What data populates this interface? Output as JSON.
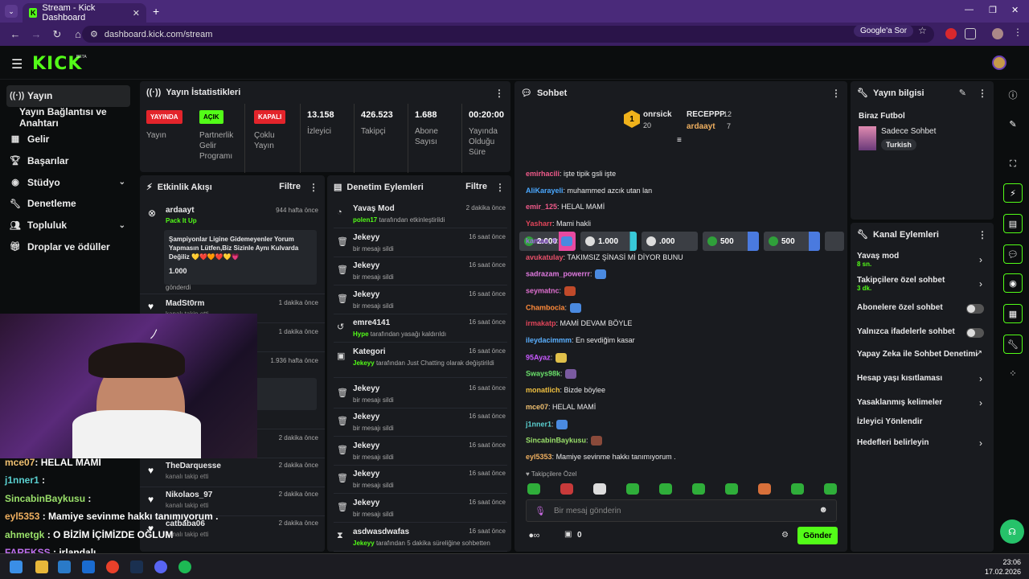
{
  "browser": {
    "tab_title": "Stream - Kick Dashboard",
    "url": "dashboard.kick.com/stream",
    "google_button": "Google'a Sor"
  },
  "header": {
    "logo": "KICK",
    "beta": "BETA"
  },
  "nav": {
    "items": [
      {
        "label": "Yayın",
        "icon": "broadcast-icon"
      },
      {
        "label": "Yayın Bağlantısı ve Anahtarı",
        "icon": ""
      },
      {
        "label": "Gelir",
        "icon": "chart-icon"
      },
      {
        "label": "Başarılar",
        "icon": "trophy-icon"
      },
      {
        "label": "Stüdyo",
        "icon": "studio-icon"
      },
      {
        "label": "Denetleme",
        "icon": "wrench-icon"
      },
      {
        "label": "Topluluk",
        "icon": "people-icon"
      },
      {
        "label": "Droplar ve ödüller",
        "icon": "gift-icon"
      }
    ]
  },
  "stats": {
    "title": "Yayın İstatistikleri",
    "cells": [
      {
        "badge": "YAYINDA",
        "label": "Yayın"
      },
      {
        "badge": "AÇIK",
        "label": "Partnerlik Gelir Programı"
      },
      {
        "badge": "KAPALI",
        "label": "Çoklu Yayın"
      },
      {
        "value": "13.158",
        "label": "İzleyici"
      },
      {
        "value": "426.523",
        "label": "Takipçi"
      },
      {
        "value": "1.688",
        "label": "Abone Sayısı"
      },
      {
        "value": "00:20:00",
        "label": "Yayında Olduğu Süre"
      }
    ]
  },
  "events": {
    "title": "Etkinlik Akışı",
    "filter": "Filtre",
    "first": {
      "name": "ardaayt",
      "sub": "Pack It Up",
      "time": "944 hafta önce",
      "message": "Şampiyonlar Ligine Gidemeyenler Yorum Yapmasın Lütfen,Biz Sizinle Aynı Kulvarda Değiliz 💛❤️🧡❤️💛💗",
      "amount": "1.000",
      "footer": "gönderdi"
    },
    "rows": [
      {
        "name": "MadSt0rm",
        "sub": "kanalı takip etti",
        "time": "1 dakika önce"
      },
      {
        "name": "",
        "sub": "",
        "time": "1 dakika önce"
      },
      {
        "name": "",
        "sub": "",
        "time": "1.936 hafta önce"
      },
      {
        "name": "",
        "sub": "",
        "time": "2 dakika önce"
      },
      {
        "name": "TheDarquesse",
        "sub": "kanalı takip etti",
        "time": "2 dakika önce"
      },
      {
        "name": "Nikolaos_97",
        "sub": "kanalı takip etti",
        "time": "2 dakika önce"
      },
      {
        "name": "catbaba06",
        "sub": "kanalı takip etti",
        "time": "2 dakika önce"
      }
    ]
  },
  "moderation": {
    "title": "Denetim Eylemleri",
    "filter": "Filtre",
    "rows": [
      {
        "name": "Yavaş Mod",
        "actor": "polen17",
        "sub": "tarafından etkinleştirildi",
        "time": "2 dakika önce",
        "icon": "slow-icon"
      },
      {
        "name": "Jekeyy",
        "actor": "",
        "sub": "bir mesajı sildi",
        "time": "16 saat önce",
        "icon": "trash-icon"
      },
      {
        "name": "Jekeyy",
        "actor": "",
        "sub": "bir mesajı sildi",
        "time": "16 saat önce",
        "icon": "trash-icon"
      },
      {
        "name": "Jekeyy",
        "actor": "",
        "sub": "bir mesajı sildi",
        "time": "16 saat önce",
        "icon": "trash-icon"
      },
      {
        "name": "emre4141",
        "actor": "Hype",
        "sub": "tarafından yasağı kaldırıldı",
        "time": "16 saat önce",
        "icon": "undo-icon"
      },
      {
        "name": "Kategori",
        "actor": "Jekeyy",
        "sub": "tarafından Just Chatting olarak değiştirildi",
        "time": "16 saat önce",
        "icon": "category-icon"
      },
      {
        "name": "Jekeyy",
        "actor": "",
        "sub": "bir mesajı sildi",
        "time": "16 saat önce",
        "icon": "trash-icon"
      },
      {
        "name": "Jekeyy",
        "actor": "",
        "sub": "bir mesajı sildi",
        "time": "16 saat önce",
        "icon": "trash-icon"
      },
      {
        "name": "Jekeyy",
        "actor": "",
        "sub": "bir mesajı sildi",
        "time": "16 saat önce",
        "icon": "trash-icon"
      },
      {
        "name": "Jekeyy",
        "actor": "",
        "sub": "bir mesajı sildi",
        "time": "16 saat önce",
        "icon": "trash-icon"
      },
      {
        "name": "Jekeyy",
        "actor": "",
        "sub": "bir mesajı sildi",
        "time": "16 saat önce",
        "icon": "trash-icon"
      },
      {
        "name": "asdwasdwafas",
        "actor": "Jekeyy",
        "sub": "tarafından 5 dakika süreliğine sohbetten",
        "time": "16 saat önce",
        "icon": "timer-icon"
      }
    ]
  },
  "chat": {
    "title": "Sohbet",
    "leaders": {
      "rank": "1",
      "first": {
        "name": "onrsick",
        "count": "20"
      },
      "second": {
        "name": "RECEPPP",
        "count": "12"
      },
      "third": {
        "name": "ardaayt",
        "count": "7"
      }
    },
    "gifts": [
      "2.000",
      "1.000",
      ".000",
      "500",
      "500"
    ],
    "messages": [
      {
        "user": "emirhacili",
        "text": "işte tipik gsli işte",
        "color": "#f05a8a"
      },
      {
        "user": "AliKarayeli",
        "text": "muhammed azcık utan lan",
        "color": "#4aa8ff"
      },
      {
        "user": "emir_125",
        "text": "HELAL MAMİ",
        "color": "#f05a8a"
      },
      {
        "user": "Yasharr",
        "text": "Mami hakli",
        "color": "#e0455a"
      },
      {
        "user": "kamaa_9",
        "text": "",
        "color": "#a06ae0"
      },
      {
        "user": "avukatulay",
        "text": "TAKIMSIZ ŞİNASİ Mİ DİYOR BUNU",
        "color": "#e8506a"
      },
      {
        "user": "sadrazam_powerrr",
        "text": "",
        "color": "#e07ae0"
      },
      {
        "user": "seymatnc",
        "text": "",
        "color": "#e070d0"
      },
      {
        "user": "Chambocia",
        "text": "",
        "color": "#ff8a3a"
      },
      {
        "user": "irmakatp",
        "text": "MAMİ DEVAM BÖYLE",
        "color": "#e0455a"
      },
      {
        "user": "ileydacimmm",
        "text": "En sevdiğim kasar",
        "color": "#5ab0ff"
      },
      {
        "user": "95Ayaz",
        "text": "",
        "color": "#c85aff"
      },
      {
        "user": "Sways98k",
        "text": "",
        "color": "#6ae06a"
      },
      {
        "user": "monatlich",
        "text": "Bizde böylee",
        "color": "#f0c040"
      },
      {
        "user": "mce07",
        "text": "HELAL MAMİ",
        "color": "#f0c070"
      },
      {
        "user": "j1nner1",
        "text": "",
        "color": "#5ad0d0"
      },
      {
        "user": "SincabinBaykusu",
        "text": "",
        "color": "#9ae06a"
      },
      {
        "user": "eyl5353",
        "text": "Mamiye sevinme hakkı tanımıyorum .",
        "color": "#f0b060"
      }
    ],
    "followers_only": "Takipçilere Özel",
    "input_placeholder": "Bir mesaj gönderin",
    "points": "0",
    "send": "Gönder"
  },
  "stream_info": {
    "title": "Yayın bilgisi",
    "stream_title": "Biraz Futbol",
    "category": "Sadece Sohbet",
    "tag": "Turkish"
  },
  "channel_actions": {
    "title": "Kanal Eylemleri",
    "items": [
      {
        "label": "Yavaş mod",
        "sub": "8 sn.",
        "control": "chevron"
      },
      {
        "label": "Takipçilere özel sohbet",
        "sub": "3 dk.",
        "control": "chevron"
      },
      {
        "label": "Abonelere özel sohbet",
        "sub": "",
        "control": "toggle"
      },
      {
        "label": "Yalnızca ifadelerle sohbet",
        "sub": "",
        "control": "toggle"
      },
      {
        "label": "Yapay Zeka ile Sohbet Denetimi",
        "sub": "",
        "control": "external"
      },
      {
        "label": "Hesap yaşı kısıtlaması",
        "sub": "",
        "control": "chevron"
      },
      {
        "label": "Yasaklanmış kelimeler",
        "sub": "",
        "control": "chevron"
      },
      {
        "label": "İzleyici Yönlendir",
        "sub": "",
        "control": ""
      },
      {
        "label": "Hedefleri belirleyin",
        "sub": "",
        "control": "chevron"
      }
    ]
  },
  "overlay_chat": [
    {
      "user": "mce07",
      "text": ": HELAL MAMİ",
      "color": "#f0c070"
    },
    {
      "user": "j1nner1",
      "text": " :",
      "color": "#5ad0d0"
    },
    {
      "user": "SincabinBaykusu",
      "text": " :",
      "color": "#9ae06a"
    },
    {
      "user": "eyl5353",
      "text": " : Mamiye sevinme hakkı tanımıyorum .",
      "color": "#f0b060"
    },
    {
      "user": "ahmetgk",
      "text": " : O BİZİM İÇİMİZDE OĞLUM",
      "color": "#9ae06a"
    },
    {
      "user": "FAREKSS",
      "text": " : irlandalı",
      "color": "#c070f0"
    }
  ],
  "taskbar": {
    "time": "23:06",
    "date": "17.02.2026"
  }
}
